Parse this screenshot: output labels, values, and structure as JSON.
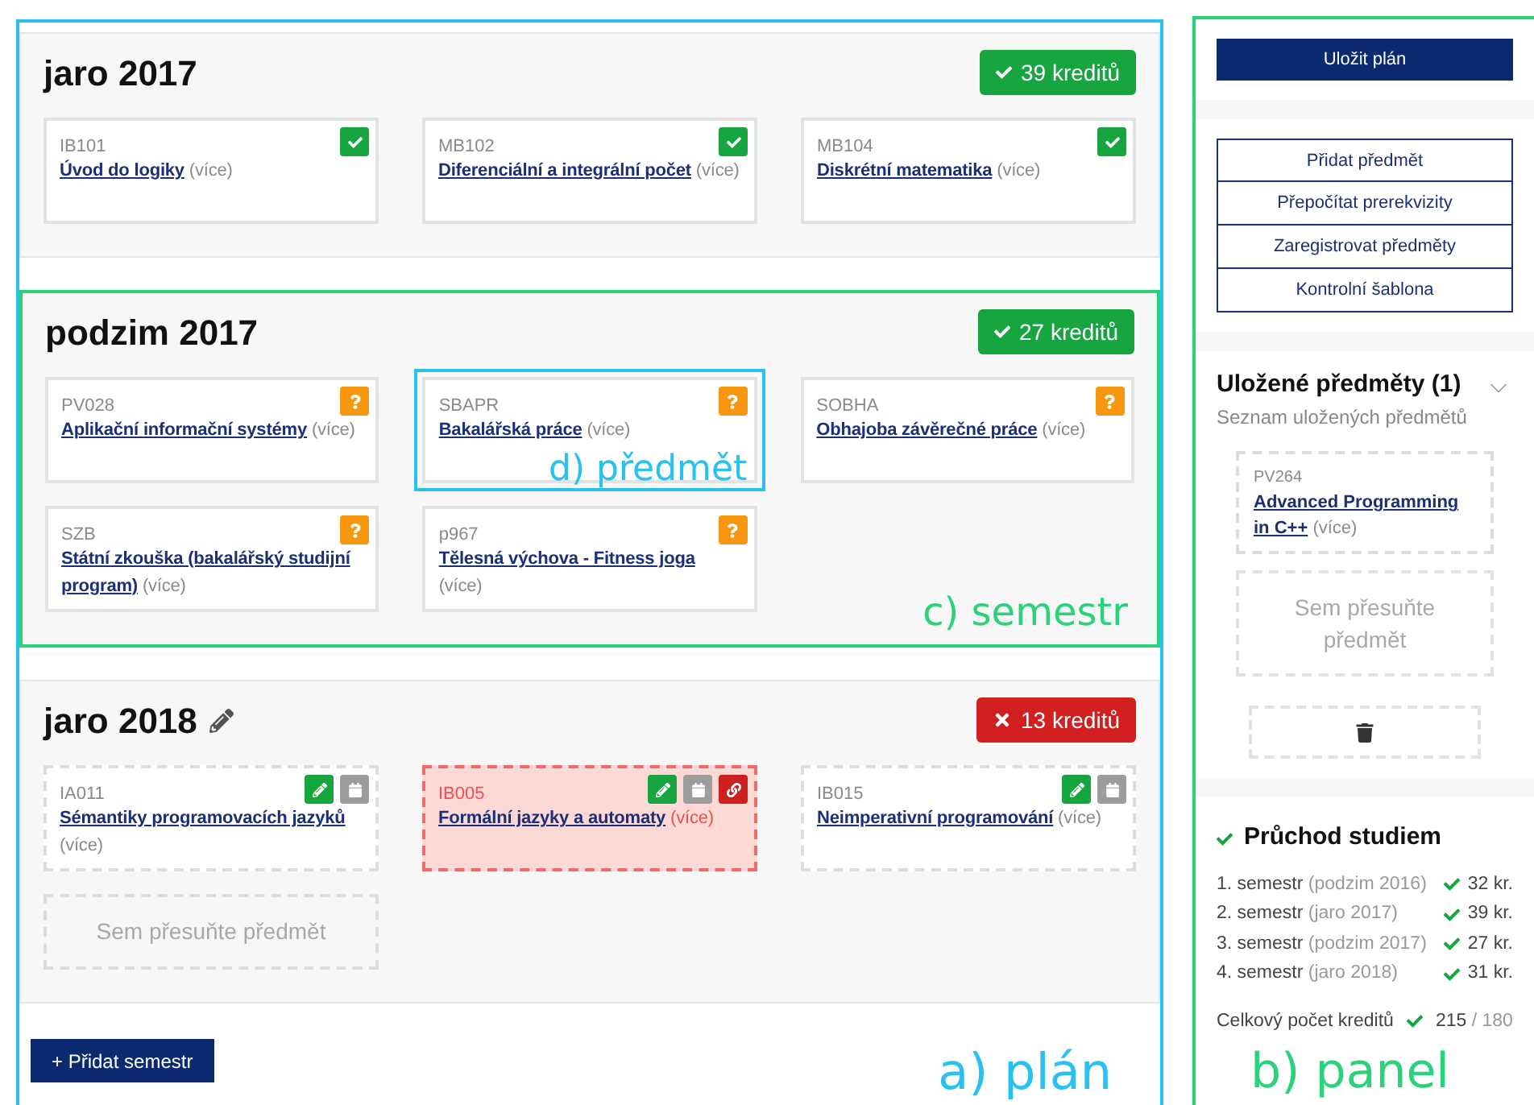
{
  "plan": {
    "annotation": "a) plán",
    "add_button": "+ Přidat semestr",
    "semesters": [
      {
        "title": "jaro 2017",
        "editable": false,
        "credits": {
          "label": "39 kreditů",
          "ok": true
        },
        "courses": [
          {
            "kind": "passed",
            "conflict": false,
            "code": "IB101",
            "name": "Úvod do logiky",
            "more": "(více)"
          },
          {
            "kind": "passed",
            "conflict": false,
            "code": "MB102",
            "name": "Diferenciální a integrální počet",
            "more": "(více)"
          },
          {
            "kind": "passed",
            "conflict": false,
            "code": "MB104",
            "name": "Diskrétní matematika",
            "more": "(více)"
          }
        ]
      },
      {
        "title": "podzim 2017",
        "editable": false,
        "annotation": "c) semestr",
        "credits": {
          "label": "27 kreditů",
          "ok": true
        },
        "courses": [
          {
            "kind": "pending",
            "conflict": false,
            "code": "PV028",
            "name": "Aplikační informační systémy",
            "more": "(více)"
          },
          {
            "kind": "pending",
            "conflict": false,
            "code": "SBAPR",
            "name": "Bakalářská práce",
            "more": "(více)",
            "annotation": "d) předmět"
          },
          {
            "kind": "pending",
            "conflict": false,
            "code": "SOBHA",
            "name": "Obhajoba závěrečné práce",
            "more": "(více)"
          },
          {
            "kind": "pending",
            "conflict": false,
            "code": "SZB",
            "name": "Státní zkouška (bakalářský studijní program)",
            "more": "(více)"
          },
          {
            "kind": "pending",
            "conflict": false,
            "code": "p967",
            "name": "Tělesná výchova - Fitness joga",
            "more": "(více)"
          }
        ]
      },
      {
        "title": "jaro 2018",
        "editable": true,
        "credits": {
          "label": "13 kreditů",
          "ok": false
        },
        "courses": [
          {
            "kind": "planned",
            "conflict": false,
            "code": "IA011",
            "name": "Sémantiky programovacích jazyků",
            "more": "(více)"
          },
          {
            "kind": "planned",
            "conflict": true,
            "code": "IB005",
            "name": "Formální jazyky a automaty",
            "more": "(více)"
          },
          {
            "kind": "planned",
            "conflict": false,
            "code": "IB015",
            "name": "Neimperativní programování",
            "more": "(více)"
          },
          {
            "kind": "dropzone",
            "text": "Sem přesuňte předmět"
          }
        ]
      }
    ]
  },
  "panel": {
    "annotation": "b) panel",
    "save_button": "Uložit plán",
    "actions": [
      "Přidat předmět",
      "Přepočítat prerekvizity",
      "Zaregistrovat předměty",
      "Kontrolní šablona"
    ],
    "saved": {
      "title": "Uložené předměty (1)",
      "subtitle": "Seznam uložených předmětů",
      "courses": [
        {
          "code": "PV264",
          "name": "Advanced Programming in C++",
          "more": "(více)"
        }
      ],
      "dropzone": "Sem přesuňte předmět"
    },
    "progress": {
      "title": "Průchod studiem",
      "ok": true,
      "semesters": [
        {
          "label": "1. semestr",
          "term": "(podzim 2016)",
          "ok": true,
          "credits": "32 kr."
        },
        {
          "label": "2. semestr",
          "term": "(jaro 2017)",
          "ok": true,
          "credits": "39 kr."
        },
        {
          "label": "3. semestr",
          "term": "(podzim 2017)",
          "ok": true,
          "credits": "27 kr."
        },
        {
          "label": "4. semestr",
          "term": "(jaro 2018)",
          "ok": true,
          "credits": "31 kr."
        }
      ],
      "total": {
        "label": "Celkový počet kreditů",
        "ok": true,
        "value": "215",
        "max": "/ 180"
      }
    }
  }
}
